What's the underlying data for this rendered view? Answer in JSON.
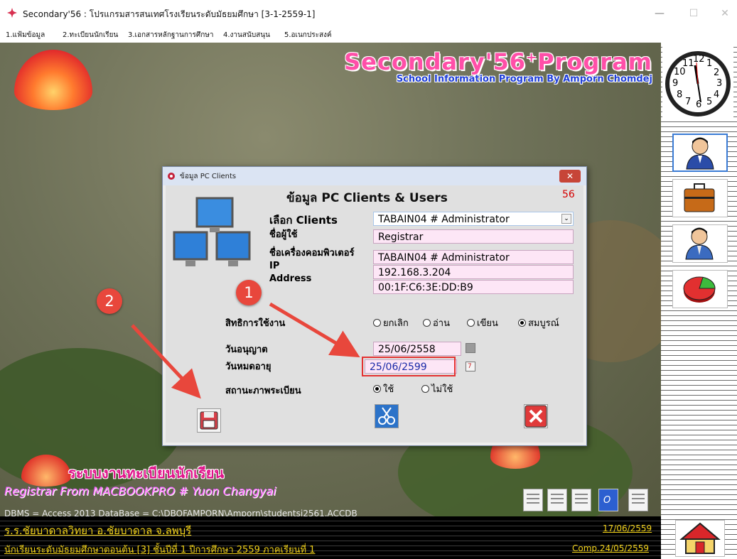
{
  "window": {
    "title": "Secondary'56 : โปรแกรมสารสนเทศโรงเรียนระดับมัธยมศึกษา [3-1-2559-1]",
    "controls": {
      "minimize": "—",
      "maximize": "☐",
      "close": "✕"
    }
  },
  "menu": [
    "1.แฟ้มข้อมูล",
    "2.ทะเบียนนักเรียน",
    "3.เอกสารหลักฐานการศึกษา",
    "4.งานสนับสนุน",
    "5.อเนกประสงค์"
  ],
  "brand": {
    "title": "Secondary'56",
    "sup": "+",
    "title2": "Program",
    "subtitle": "School Information Program By Amporn Chomdej"
  },
  "clock": {
    "numbers": [
      "12",
      "1",
      "2",
      "3",
      "4",
      "5",
      "6",
      "7",
      "8",
      "9",
      "10",
      "11"
    ]
  },
  "dialog": {
    "title": "ข้อมูล PC Clients",
    "header": "ข้อมูล PC Clients & Users",
    "count": "56",
    "labels": {
      "select_client": "เลือก Clients",
      "username": "ชื่อผู้ใช้",
      "computer_name": "ชื่อเครื่องคอมพิวเตอร์",
      "ip": "IP",
      "address": "Address",
      "rights": "สิทธิการใช้งาน",
      "permit_date": "วันอนุญาต",
      "expire_date": "วันหมดอายุ",
      "status": "สถานะภาพระเบียน"
    },
    "values": {
      "client": "TABAIN04 # Administrator",
      "username": "Registrar",
      "computer_name": "TABAIN04 # Administrator",
      "ip": "192.168.3.204",
      "mac": "00:1F:C6:3E:DD:B9",
      "permit_date": "25/06/2558",
      "expire_date": "25/06/2599"
    },
    "rights_options": [
      "ยกเลิก",
      "อ่าน",
      "เขียน",
      "สมบูรณ์"
    ],
    "rights_selected": "สมบูรณ์",
    "status_options": [
      "ใช้",
      "ไม่ใช้"
    ],
    "status_selected": "ใช้"
  },
  "annotations": {
    "badge1": "1",
    "badge2": "2"
  },
  "main": {
    "system_title": "ระบบงานทะเบียนนักเรียน",
    "registrar": "Registrar From MACBOOKPRO # Yuon Changyai",
    "dbms": "DBMS = Access 2013  DataBase = C:\\DBOFAMPORN\\Amporn\\studentsj2561.ACCDB"
  },
  "status_bar": {
    "school": "ร.ร.ชัยบาดาลวิทยา  อ.ชัยบาดาล  จ.ลพบุรี",
    "level": "นักเรียนระดับมัธยมศึกษาตอนต้น [3]  ชั้นปีที่ 1  ปีการศึกษา 2559  ภาคเรียนที่  1",
    "date": "17/06/2559",
    "comp": "Comp.24/05/2559"
  },
  "colors": {
    "accent_pink": "#ff4fa8",
    "accent_blue": "#1f3fd8",
    "status_yellow": "#f2d21a",
    "annotation_red": "#e8473c"
  }
}
